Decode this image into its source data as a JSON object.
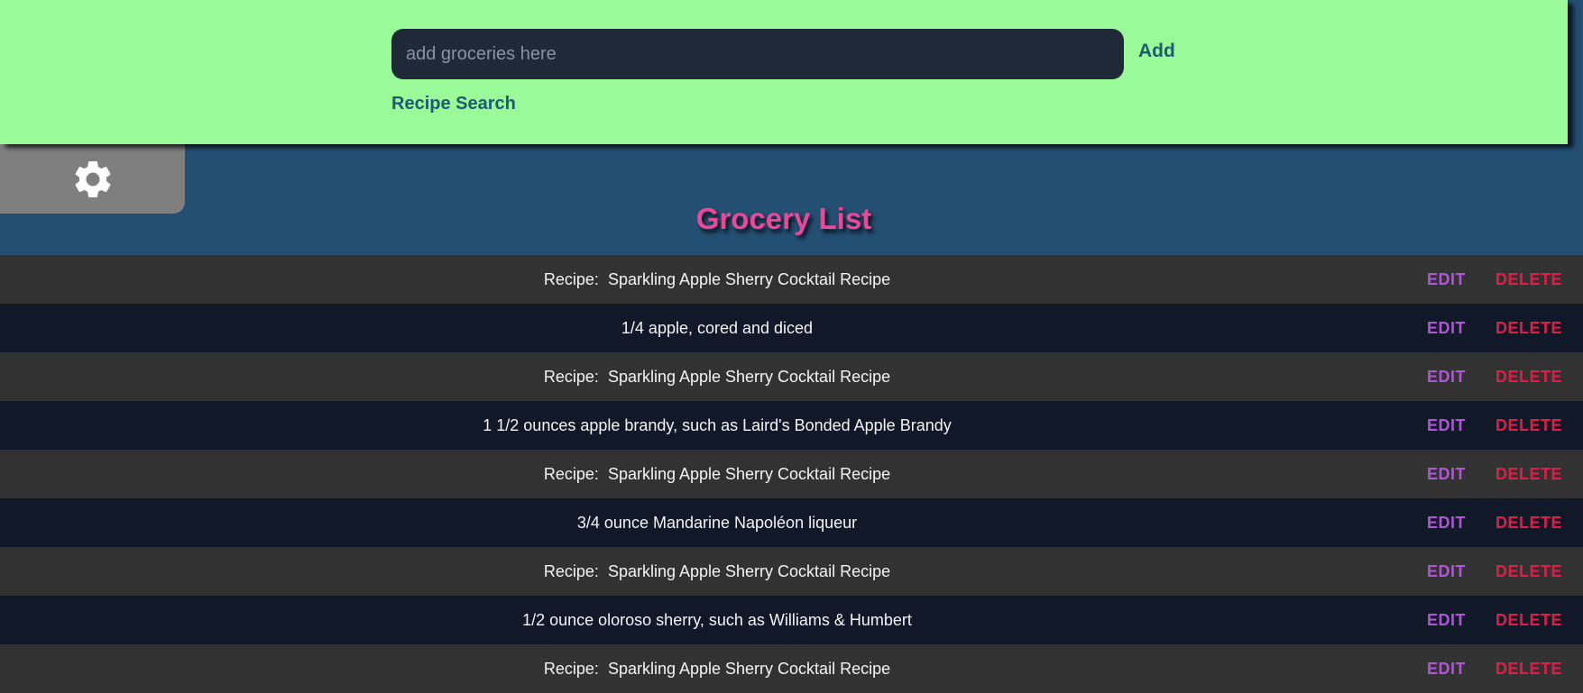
{
  "header": {
    "search_placeholder": "add groceries here",
    "search_value": "",
    "add_label": "Add",
    "recipe_search_label": "Recipe Search",
    "settings_icon": "gear-icon"
  },
  "title": "Grocery List",
  "list": {
    "edit_label": "EDIT",
    "delete_label": "DELETE",
    "items": [
      "Recipe:  Sparkling Apple Sherry Cocktail Recipe",
      "1/4 apple, cored and diced",
      "Recipe:  Sparkling Apple Sherry Cocktail Recipe",
      "1 1/2 ounces apple brandy, such as Laird's Bonded Apple Brandy",
      "Recipe:  Sparkling Apple Sherry Cocktail Recipe",
      "3/4 ounce Mandarine Napoléon liqueur",
      "Recipe:  Sparkling Apple Sherry Cocktail Recipe",
      "1/2 ounce oloroso sherry, such as Williams & Humbert",
      "Recipe:  Sparkling Apple Sherry Cocktail Recipe"
    ]
  },
  "colors": {
    "header_bg": "#9afa97",
    "page_bg": "#234f73",
    "row_odd": "#323232",
    "row_even": "#111827",
    "title": "#ec4899",
    "edit": "#b154d8",
    "delete": "#e11d48"
  }
}
